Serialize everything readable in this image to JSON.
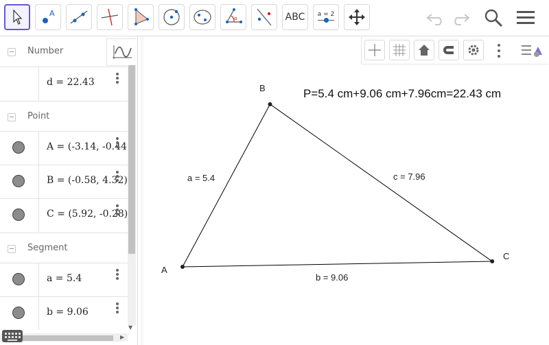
{
  "toolbar": {
    "text_tool": "ABC",
    "slider_tool": "a = 2"
  },
  "algebra": {
    "groups": [
      {
        "label": "Number",
        "items": [
          {
            "value": "d = 22.43"
          }
        ]
      },
      {
        "label": "Point",
        "items": [
          {
            "value": "A = (-3.14, -0.44"
          },
          {
            "value": "B = (-0.58, 4.32)"
          },
          {
            "value": "C = (5.92, -0.28)"
          }
        ]
      },
      {
        "label": "Segment",
        "items": [
          {
            "value": "a = 5.4"
          },
          {
            "value": "b = 9.06"
          }
        ]
      }
    ]
  },
  "graphics": {
    "points": [
      {
        "name": "A",
        "x": -3.14,
        "y": -0.44
      },
      {
        "name": "B",
        "x": -0.58,
        "y": 4.32
      },
      {
        "name": "C",
        "x": 5.92,
        "y": -0.28
      }
    ],
    "segment_labels": {
      "a": "a = 5.4",
      "b": "b = 9.06",
      "c": "c = 7.96"
    },
    "perimeter_text": "P=5.4 cm+9.06 cm+7.96cm=22.43 cm"
  },
  "colors": {
    "accent": "#6557d2",
    "point_fill": "#8c8c8c",
    "tool_point": "#1565c0"
  }
}
